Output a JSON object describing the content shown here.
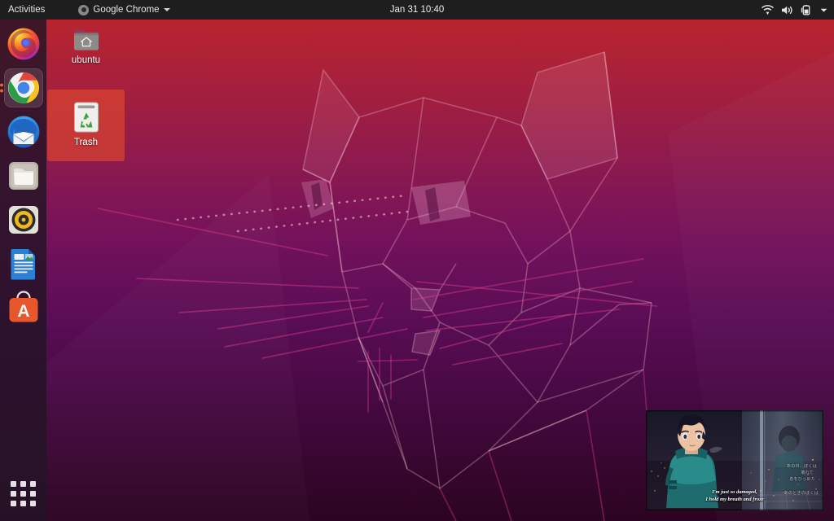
{
  "topbar": {
    "activities_label": "Activities",
    "app_menu_label": "Google Chrome",
    "app_menu_icon": "chrome-icon",
    "caret_icon": "chevron-down-icon",
    "clock": "Jan 31  10:40",
    "tray": [
      {
        "name": "wifi-icon",
        "label": "Wi-Fi"
      },
      {
        "name": "volume-icon",
        "label": "Volume"
      },
      {
        "name": "battery-charging-icon",
        "label": "Battery"
      },
      {
        "name": "chevron-down-icon",
        "label": "System menu"
      }
    ]
  },
  "dock": {
    "items": [
      {
        "name": "dock-item-firefox",
        "label": "Firefox",
        "icon": "firefox-icon",
        "running": false,
        "windows": 0
      },
      {
        "name": "dock-item-google-chrome",
        "label": "Google Chrome",
        "icon": "chrome-icon",
        "running": true,
        "windows": 2
      },
      {
        "name": "dock-item-thunderbird",
        "label": "Thunderbird Mail",
        "icon": "thunderbird-icon",
        "running": false,
        "windows": 0
      },
      {
        "name": "dock-item-files",
        "label": "Files",
        "icon": "files-folder-icon",
        "running": false,
        "windows": 0
      },
      {
        "name": "dock-item-rhythmbox",
        "label": "Rhythmbox",
        "icon": "rhythmbox-icon",
        "running": false,
        "windows": 0
      },
      {
        "name": "dock-item-libreoffice-writer",
        "label": "LibreOffice Writer",
        "icon": "libreoffice-writer-icon",
        "running": false,
        "windows": 0
      },
      {
        "name": "dock-item-ubuntu-software",
        "label": "Ubuntu Software",
        "icon": "ubuntu-software-icon",
        "running": false,
        "windows": 0
      }
    ],
    "show_apps": {
      "name": "show-applications-button",
      "label": "Show Applications",
      "icon": "app-grid-icon"
    }
  },
  "desktop": {
    "icons": [
      {
        "name": "desktop-icon-ubuntu-home",
        "label": "ubuntu",
        "icon": "home-folder-icon",
        "selected": false
      },
      {
        "name": "desktop-icon-trash",
        "label": "Trash",
        "icon": "trash-icon",
        "selected": true
      }
    ]
  },
  "video_pip": {
    "name": "video-thumbnail",
    "subtitle_line1": "I'm just so damaged,",
    "subtitle_line2": "I hold my breath and froze",
    "overlay_text_1": "あの日、ぼくは",
    "overlay_text_2": "壊れて",
    "overlay_text_3": "息をひっめた",
    "overlay_text_4": "あのときのぼくは"
  },
  "colors": {
    "topbar_bg": "#1E1E1E",
    "dock_bg": "#231426",
    "wallpaper_top": "#B8242F",
    "wallpaper_mid": "#6B1161",
    "wallpaper_bottom": "#2C0421",
    "selection": "#E34A2D",
    "running_dot": "#E8622A"
  }
}
